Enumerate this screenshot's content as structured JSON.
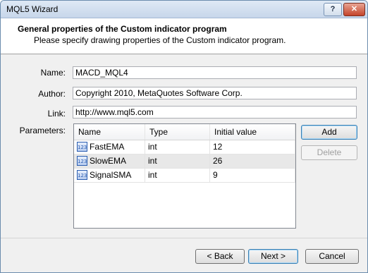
{
  "window": {
    "title": "MQL5 Wizard"
  },
  "header": {
    "title": "General properties of the Custom indicator program",
    "subtitle": "Please specify drawing properties of the Custom indicator program."
  },
  "form": {
    "name_label": "Name:",
    "name_value": "MACD_MQL4",
    "author_label": "Author:",
    "author_value": "Copyright 2010, MetaQuotes Software Corp.",
    "link_label": "Link:",
    "link_value": "http://www.mql5.com",
    "parameters_label": "Parameters:"
  },
  "parameters": {
    "columns": [
      "Name",
      "Type",
      "Initial value"
    ],
    "icon_text": "123",
    "rows": [
      {
        "name": "FastEMA",
        "type": "int",
        "value": "12"
      },
      {
        "name": "SlowEMA",
        "type": "int",
        "value": "26"
      },
      {
        "name": "SignalSMA",
        "type": "int",
        "value": "9"
      }
    ]
  },
  "buttons": {
    "add": "Add",
    "delete": "Delete",
    "back": "< Back",
    "next": "Next >",
    "cancel": "Cancel"
  },
  "titlebar": {
    "help_glyph": "?",
    "close_glyph": "✕"
  }
}
